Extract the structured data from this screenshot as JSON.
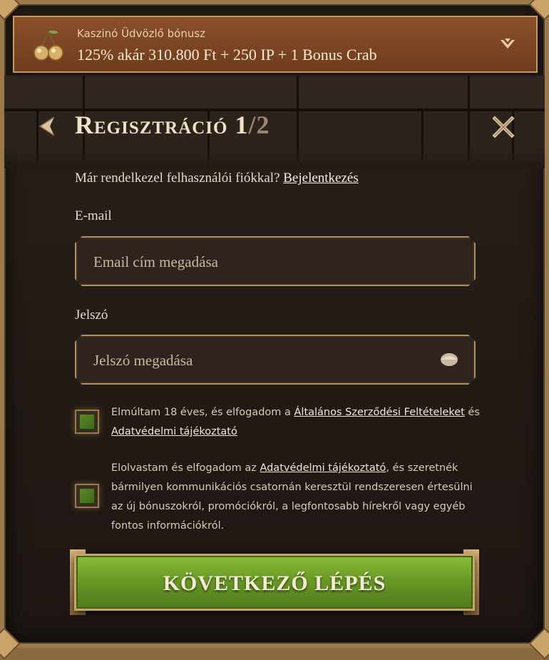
{
  "banner": {
    "subtitle": "Kaszinó Üdvözlő bónusz",
    "offer": "125% akár 310.800 Ft + 250 IP + 1 Bonus Crab"
  },
  "header": {
    "title_main": "Regisztráció 1",
    "title_sep": "/2"
  },
  "account_prompt": {
    "text": "Már rendelkezel felhasználói fiókkal? ",
    "login_link": "Bejelentkezés"
  },
  "email": {
    "label": "E-mail",
    "placeholder": "Email cím megadása",
    "value": ""
  },
  "password": {
    "label": "Jelszó",
    "placeholder": "Jelszó megadása",
    "value": ""
  },
  "consent1": {
    "checked": true,
    "text_before": "Elmúltam 18 éves, és elfogadom a ",
    "link1": "Általános Szerződési Feltételeket",
    "text_mid": " és ",
    "link2": "Adatvédelmi tájékoztató"
  },
  "consent2": {
    "checked": true,
    "text_before": "Elolvastam és elfogadom az ",
    "link": "Adatvédelmi tájékoztató",
    "text_after": ", és szeretnék bármilyen kommunikációs csatornán keresztül rendszeresen értesülni az új bónuszokról, promóciókról, a legfontosabb hírekről vagy egyéb fontos információkról."
  },
  "cta": {
    "label": "KÖVETKEZŐ LÉPÉS"
  },
  "icons": {
    "banner": "cherries-icon",
    "expand": "chevron-down-icon",
    "back": "arrow-left-icon",
    "close": "close-icon",
    "password_toggle": "eye-icon"
  },
  "colors": {
    "cta": "#6a9a26",
    "banner": "#7a4424",
    "gold_border": "#c9a36a"
  }
}
